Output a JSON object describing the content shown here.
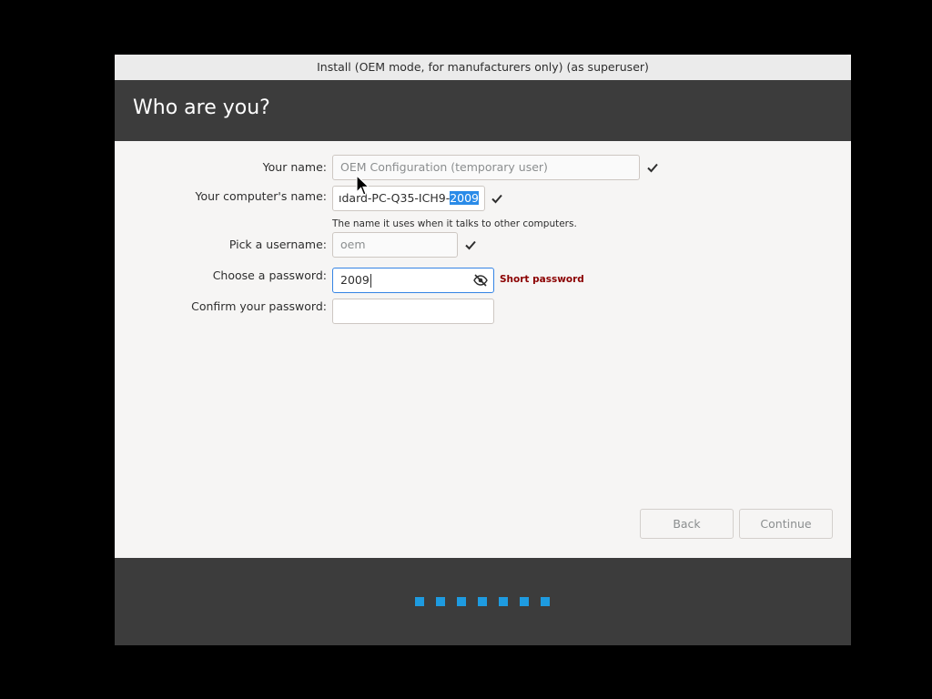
{
  "window": {
    "title": "Install (OEM mode, for manufacturers only) (as superuser)"
  },
  "header": {
    "title": "Who are you?"
  },
  "form": {
    "your_name": {
      "label": "Your name:",
      "placeholder": "OEM Configuration (temporary user)"
    },
    "computer_name": {
      "label": "Your computer's name:",
      "value_prefix": "ıdard-PC-Q35-ICH9-",
      "value_selected": "2009",
      "hint": "The name it uses when it talks to other computers."
    },
    "username": {
      "label": "Pick a username:",
      "placeholder": "oem"
    },
    "password": {
      "label": "Choose a password:",
      "value": "2009",
      "strength": "Short password"
    },
    "confirm_password": {
      "label": "Confirm your password:",
      "value": ""
    }
  },
  "buttons": {
    "back": "Back",
    "continue": "Continue"
  },
  "progress": {
    "dots": 7
  },
  "colors": {
    "header_bg": "#3c3c3c",
    "selection": "#2a8be8",
    "warning": "#8b0000",
    "progress_dot": "#1e9be0",
    "focus_border": "#3584e4"
  },
  "icons": {
    "valid": "check-icon",
    "password_visibility": "eye-slash-icon",
    "pointer": "cursor-icon"
  }
}
